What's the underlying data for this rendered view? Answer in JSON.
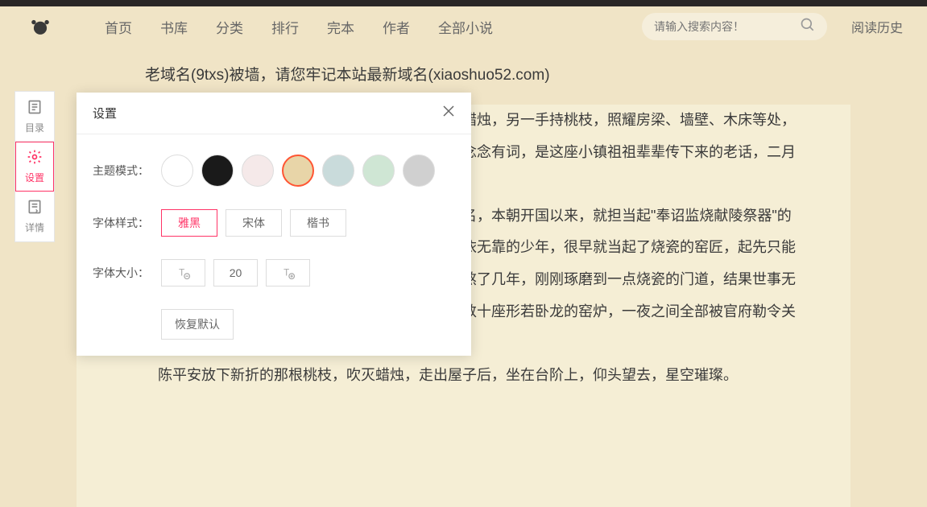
{
  "nav": {
    "items": [
      "首页",
      "书库",
      "分类",
      "排行",
      "完本",
      "作者",
      "全部小说"
    ]
  },
  "search": {
    "placeholder": "请输入搜索内容！"
  },
  "history": "阅读历史",
  "banner": "老域名(9txs)被墙，请您牢记本站最新域名(xiaoshuo52.com)",
  "sidebar": {
    "items": [
      {
        "label": "目录"
      },
      {
        "label": "设置"
      },
      {
        "label": "详情"
      }
    ]
  },
  "reading": {
    "p1": "苦伶仃的清瘦少年，此时他正按照习俗，一手持蜡烛，另一手持桃枝，照耀房梁、墙壁、木床等处，用桃枝敲敲打打，试图借此驱赶蛇蝎、蜈蚣等，嘴里念念有词，是这座小镇祖祖辈辈传下来的老话，二月二，烛照梁，桃打墙，人间蛇虫无处藏。",
    "p2": "少年姓陈，名平安，爹娘早逝。小镇瓷器极负盛名，本朝开国以来，就担当起\"奉诏监烧献陵祭器\"的重任，有朝廷官员常年驻扎此地，监理官窑事务。无依无靠的少年，很早就当起了烧瓷的窑匠，起先只能做些杂事粗活，跟着一个脾气糟糕的半路师傅，辛苦熬了几年，刚刚琢磨到一点烧瓷的门道，结果世事无常，小镇突然失去了官窑造办这张护身符，小镇周边数十座形若卧龙的窑炉，一夜之间全部被官府勒令关闭熄火。",
    "p3": "陈平安放下新折的那根桃枝，吹灭蜡烛，走出屋子后，坐在台阶上，仰头望去，星空璀璨。"
  },
  "settings": {
    "title": "设置",
    "theme_label": "主题模式：",
    "themes": [
      "#ffffff",
      "#1a1a1a",
      "#f5e9e9",
      "#e8d5a8",
      "#c9dbdb",
      "#cfe6d4",
      "#d0d0d0"
    ],
    "theme_selected": 3,
    "font_label": "字体样式：",
    "fonts": [
      "雅黑",
      "宋体",
      "楷书"
    ],
    "font_selected": 0,
    "size_label": "字体大小：",
    "size_value": "20",
    "reset": "恢复默认"
  }
}
